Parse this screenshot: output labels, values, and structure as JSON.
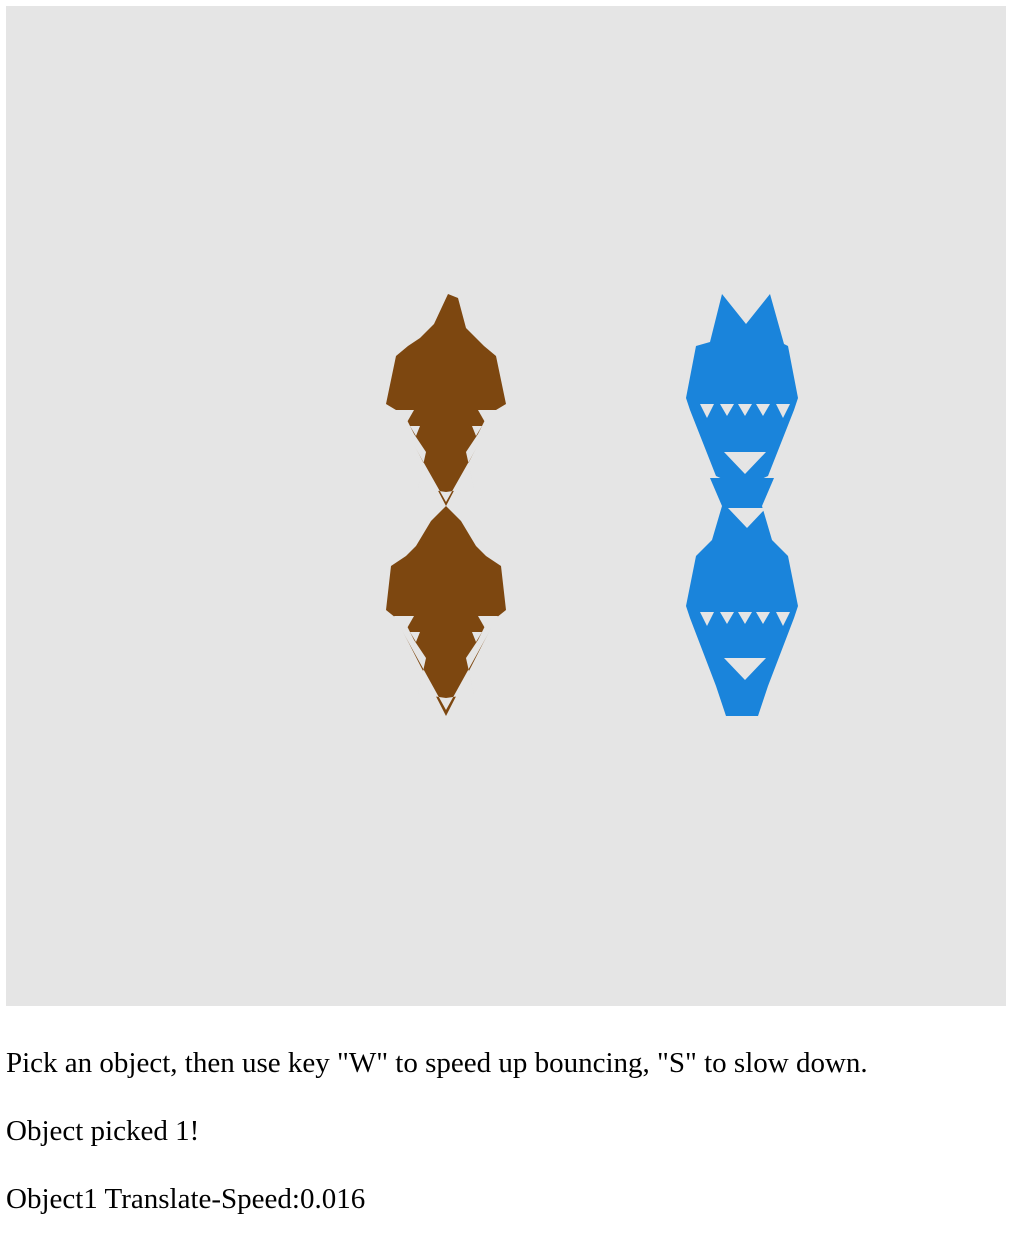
{
  "canvas": {
    "background": "#e5e5e5",
    "objects": [
      {
        "name": "object-1",
        "color": "#7d4710",
        "shape": "sierpinski-triangle-pair"
      },
      {
        "name": "object-2",
        "color": "#1a84db",
        "shape": "sierpinski-triangle-pair"
      }
    ]
  },
  "instructions": "Pick an object, then use key \"W\" to speed up bouncing, \"S\" to slow down.",
  "picked_status": "Object picked 1!",
  "speed_readout": "Object1 Translate-Speed:0.016"
}
